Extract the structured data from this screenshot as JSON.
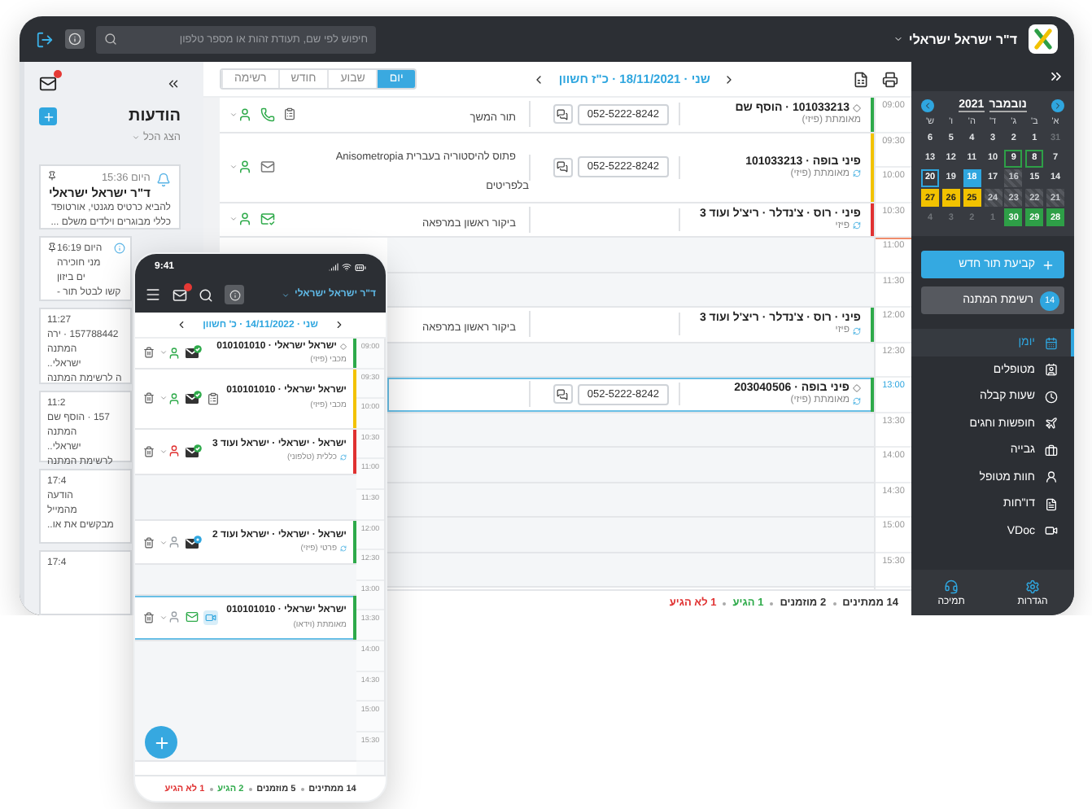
{
  "topbar": {
    "user": "ד\"ר ישראל ישראלי",
    "search": {
      "placeholder": "חיפוש לפי שם, תעודת זהות או מספר טלפון"
    }
  },
  "notifications": {
    "title": "הודעות",
    "filter": "הצג הכל",
    "cards": [
      {
        "kind": "reminder",
        "pinned": true,
        "time": "היום 15:36",
        "name": "ד\"ר ישראל ישראלי",
        "lines": [
          "להביא כרטיס מגנטי, אורטופד",
          "כללי מבוגרים וילדים משלם ..."
        ]
      },
      {
        "kind": "partial",
        "pinned": true,
        "lines": [
          "היום 16:19",
          "מני חוכירה",
          "ים ביזון",
          "קשו לבטל תור -"
        ]
      },
      {
        "kind": "covered",
        "pinned": false,
        "lines": [
          "11:27",
          "157788442 · ירה",
          "המתנה",
          "ישראלי..",
          "ה לרשימת המתנה"
        ]
      },
      {
        "kind": "covered",
        "pinned": false,
        "lines": [
          "11:2",
          "157 · הוסף שם",
          "המתנה",
          "ישראלי..",
          "לרשימת המתנה"
        ]
      },
      {
        "kind": "covered",
        "pinned": false,
        "lines": [
          "17:4",
          "הודעה",
          "מהמייל",
          "מבקשים את או.."
        ]
      },
      {
        "kind": "covered",
        "pinned": false,
        "lines": [
          "17:4"
        ]
      }
    ]
  },
  "center": {
    "views": [
      {
        "label": "יום",
        "selected": true
      },
      {
        "label": "שבוע",
        "selected": false
      },
      {
        "label": "חודש",
        "selected": false
      },
      {
        "label": "רשימה",
        "selected": false
      }
    ],
    "date": "שני · 18/11/2021 · כ\"ז חשוון",
    "times": [
      {
        "label": "09:00",
        "selected": false
      },
      {
        "label": "09:30",
        "selected": false
      },
      {
        "label": "10:00",
        "selected": false
      },
      {
        "label": "10:30",
        "selected": false
      },
      {
        "label": "11:00",
        "selected": false
      },
      {
        "label": "11:30",
        "selected": false
      },
      {
        "label": "12:00",
        "selected": false
      },
      {
        "label": "12:30",
        "selected": false
      },
      {
        "label": "13:00",
        "selected": true
      },
      {
        "label": "13:30",
        "selected": false
      },
      {
        "label": "14:00",
        "selected": false
      },
      {
        "label": "14:30",
        "selected": false
      },
      {
        "label": "15:00",
        "selected": false
      },
      {
        "label": "15:30",
        "selected": false
      }
    ],
    "appointments": [
      {
        "kind": "appointment",
        "title": "101033213 · הוסף שם",
        "pinned": true,
        "subtitle": "מאומתת (פיזי)",
        "synced": false,
        "phone": "052-5222-8242",
        "note": "תור המשך",
        "color": "#2eaa4a",
        "selected": false,
        "patient": {
          "kind": "arrived"
        },
        "actions": [
          {
            "kind": "phone"
          },
          {
            "kind": "clipboard"
          }
        ]
      },
      {
        "kind": "appointment",
        "title": "פיני בופה · 101033213",
        "pinned": false,
        "subtitle": "מאומתת (פיזי)",
        "synced": true,
        "phone": "052-5222-8242",
        "note": "פתוס להיסטוריה בעברית Anisometropia בלפריטים",
        "color": "#f2c200",
        "selected": false,
        "patient": {
          "kind": "arrived"
        },
        "message": {
          "kind": "sent"
        }
      },
      {
        "kind": "appointment",
        "title": "פיני · רוס · צ'נדלר · ריצ'ל ועוד 3",
        "pinned": false,
        "subtitle": "פיזי",
        "synced": true,
        "note": "ביקור ראשון במרפאה",
        "color": "#e03131",
        "selected": false,
        "patient": {
          "kind": "arrived"
        },
        "message": {
          "kind": "confirmed"
        }
      },
      {
        "kind": "free"
      },
      {
        "kind": "appointment",
        "title": "פיני · רוס · צ'נדלר · ריצ'ל ועוד 3",
        "pinned": false,
        "subtitle": "פיזי",
        "synced": true,
        "note": "ביקור ראשון במרפאה",
        "color": "#2eaa4a",
        "selected": false
      },
      {
        "kind": "free"
      },
      {
        "kind": "appointment",
        "title": "פיני בופה · 203040506",
        "pinned": true,
        "subtitle": "מאומתת (פיזי)",
        "synced": true,
        "phone": "052-5222-8242",
        "color": "#2eaa4a",
        "selected": true
      },
      {
        "kind": "free"
      }
    ],
    "summary": [
      {
        "text": "14 ממתינים",
        "kind": "waiting"
      },
      {
        "text": "2 מוזמנים",
        "kind": "invited"
      },
      {
        "text": "1 הגיע",
        "kind": "arrived"
      },
      {
        "text": "1 לא הגיע",
        "kind": "absent"
      }
    ]
  },
  "sidebar": {
    "calendar": {
      "month": "נובמבר",
      "year": "2021",
      "weekdays": [
        "א'",
        "ב'",
        "ג'",
        "ד'",
        "ה'",
        "ו'",
        "ש'"
      ],
      "days": [
        {
          "label": "31",
          "kind": "dim"
        },
        {
          "label": "1",
          "kind": "plain"
        },
        {
          "label": "2",
          "kind": "plain"
        },
        {
          "label": "3",
          "kind": "plain"
        },
        {
          "label": "4",
          "kind": "plain"
        },
        {
          "label": "5",
          "kind": "plain"
        },
        {
          "label": "6",
          "kind": "plain"
        },
        {
          "label": "7",
          "kind": "plain"
        },
        {
          "label": "8",
          "kind": "marked"
        },
        {
          "label": "9",
          "kind": "marked"
        },
        {
          "label": "10",
          "kind": "plain"
        },
        {
          "label": "11",
          "kind": "plain"
        },
        {
          "label": "12",
          "kind": "plain"
        },
        {
          "label": "13",
          "kind": "plain"
        },
        {
          "label": "14",
          "kind": "plain"
        },
        {
          "label": "15",
          "kind": "plain"
        },
        {
          "label": "16",
          "kind": "blocked"
        },
        {
          "label": "17",
          "kind": "plain"
        },
        {
          "label": "18",
          "kind": "selected"
        },
        {
          "label": "19",
          "kind": "plain"
        },
        {
          "label": "20",
          "kind": "today"
        },
        {
          "label": "21",
          "kind": "blocked"
        },
        {
          "label": "22",
          "kind": "blocked"
        },
        {
          "label": "23",
          "kind": "blocked"
        },
        {
          "label": "24",
          "kind": "blocked"
        },
        {
          "label": "25",
          "kind": "busy"
        },
        {
          "label": "26",
          "kind": "busy"
        },
        {
          "label": "27",
          "kind": "busy"
        },
        {
          "label": "28",
          "kind": "free"
        },
        {
          "label": "29",
          "kind": "free"
        },
        {
          "label": "30",
          "kind": "free"
        },
        {
          "label": "1",
          "kind": "dim"
        },
        {
          "label": "2",
          "kind": "dim"
        },
        {
          "label": "3",
          "kind": "dim"
        },
        {
          "label": "4",
          "kind": "dim"
        }
      ]
    },
    "new_appointment": "קביעת תור חדש",
    "waiting_list": {
      "label": "רשימת המתנה",
      "count": "14"
    },
    "nav": [
      {
        "label": "יומן",
        "selected": true
      },
      {
        "label": "מטופלים",
        "selected": false
      },
      {
        "label": "שעות קבלה",
        "selected": false
      },
      {
        "label": "חופשות וחגים",
        "selected": false
      },
      {
        "label": "גבייה",
        "selected": false
      },
      {
        "label": "חוות מטופל",
        "selected": false
      },
      {
        "label": "דו\"חות",
        "selected": false
      },
      {
        "label": "VDoc",
        "selected": false
      }
    ],
    "bottom": [
      "הגדרות",
      "תמיכה"
    ]
  },
  "phone": {
    "time": "9:41",
    "user": "ד\"ר ישראל ישראלי",
    "date": "שני · 14/11/2022 · כ' חשוון",
    "times": [
      "09:00",
      "09:30",
      "10:00",
      "10:30",
      "11:00",
      "11:30",
      "12:00",
      "12:30",
      "13:00",
      "13:30",
      "14:00",
      "14:30",
      "15:00",
      "15:30"
    ],
    "appointments": [
      {
        "kind": "appointment",
        "title": "ישראל ישראלי · 010101010",
        "pinned": true,
        "subtitle": "מכבי (פיזי)",
        "synced": false,
        "color": "#2eaa4a",
        "selected": false,
        "patient": {
          "kind": "arrived"
        },
        "message": {
          "kind": "approved"
        }
      },
      {
        "kind": "appointment",
        "title": "ישראל ישראלי · 010101010",
        "pinned": false,
        "subtitle": "מכבי (פיזי)",
        "synced": false,
        "color": "#f2c200",
        "selected": false,
        "patient": {
          "kind": "arrived"
        },
        "message": {
          "kind": "approved"
        },
        "actions": [
          {
            "kind": "clipboard"
          }
        ]
      },
      {
        "kind": "appointment",
        "title": "ישראל · ישראלי · ישראל ועוד 3",
        "pinned": false,
        "subtitle": "כללית (טלפוני)",
        "synced": true,
        "color": "#e03131",
        "selected": false,
        "patient": {
          "kind": "absent"
        },
        "message": {
          "kind": "approved"
        }
      },
      {
        "kind": "free"
      },
      {
        "kind": "appointment",
        "title": "ישראל · ישראלי · ישראל ועוד 2",
        "pinned": false,
        "subtitle": "פרטי (פיזי)",
        "synced": true,
        "color": "#2eaa4a",
        "selected": false,
        "patient": {
          "kind": "invited"
        },
        "message": {
          "kind": "pending"
        }
      },
      {
        "kind": "free"
      },
      {
        "kind": "appointment",
        "title": "ישראל ישראלי · 010101010",
        "pinned": false,
        "subtitle": "מאומתת (וידאו)",
        "synced": false,
        "color": "#2eaa4a",
        "selected": true,
        "patient": {
          "kind": "invited"
        },
        "message": {
          "kind": "delivered"
        },
        "actions": [
          {
            "kind": "video"
          }
        ]
      },
      {
        "kind": "free"
      }
    ],
    "summary": [
      {
        "text": "14 ממתינים",
        "kind": "waiting"
      },
      {
        "text": "5 מוזמנים",
        "kind": "invited"
      },
      {
        "text": "2 הגיע",
        "kind": "arrived"
      },
      {
        "text": "1 לא הגיע",
        "kind": "absent"
      }
    ]
  }
}
